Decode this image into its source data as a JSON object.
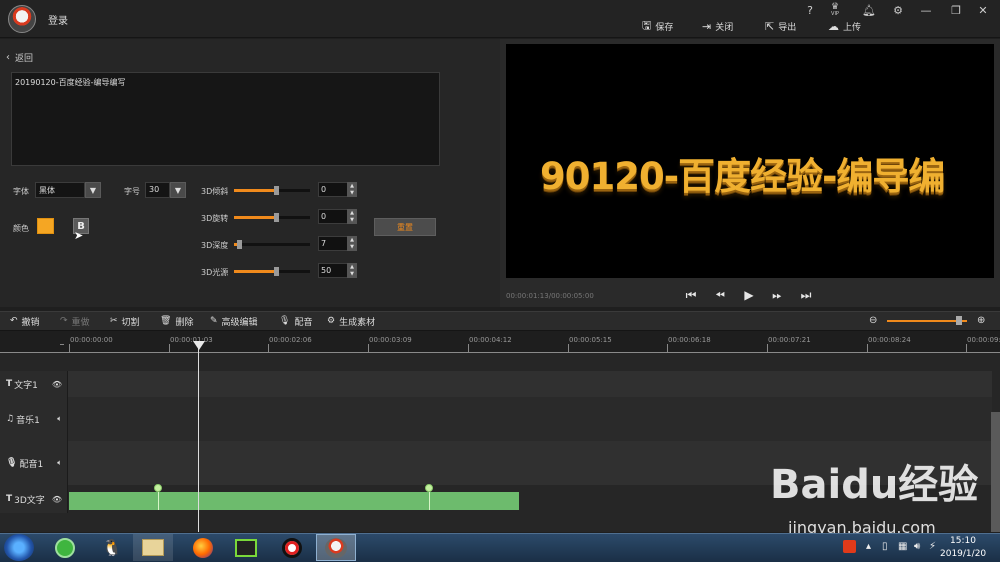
{
  "titlebar": {
    "login": "登录",
    "help_icon": "?",
    "vip_label": "VIP",
    "buttons": [
      {
        "label": "保存",
        "icon": "save-icon"
      },
      {
        "label": "关闭",
        "icon": "close-project-icon"
      },
      {
        "label": "导出",
        "icon": "export-icon"
      },
      {
        "label": "上传",
        "icon": "upload-icon"
      }
    ]
  },
  "editor": {
    "back_label": "返回",
    "text_content": "20190120-百度经验-编导编写",
    "font_label": "字体",
    "font_value": "黑体",
    "size_label": "字号",
    "size_value": "30",
    "color_label": "颜色",
    "color_value": "#f5a623",
    "bold_label": "B",
    "reset_label": "重置",
    "params": [
      {
        "label": "3D倾斜",
        "value": "0",
        "level": 0.55
      },
      {
        "label": "3D旋转",
        "value": "0",
        "level": 0.55
      },
      {
        "label": "3D深度",
        "value": "7",
        "level": 0.07
      },
      {
        "label": "3D光源",
        "value": "50",
        "level": 0.55
      }
    ]
  },
  "preview": {
    "text": "90120-百度经验-编导编",
    "timecode": "00:00:01:13/00:00:05:00"
  },
  "toolbar": {
    "items": [
      {
        "label": "撤销",
        "icon": "undo-icon",
        "enabled": true
      },
      {
        "label": "重做",
        "icon": "redo-icon",
        "enabled": false
      },
      {
        "label": "切割",
        "icon": "scissors-icon",
        "enabled": true
      },
      {
        "label": "删除",
        "icon": "trash-icon",
        "enabled": true
      },
      {
        "label": "高级编辑",
        "icon": "pencil-icon",
        "enabled": true
      },
      {
        "label": "配音",
        "icon": "microphone-icon",
        "enabled": true
      },
      {
        "label": "生成素材",
        "icon": "gear-icon",
        "enabled": true
      }
    ],
    "zoom_level": 0.9
  },
  "timeline": {
    "ruler": [
      "00:00:00:00",
      "00:00:01:03",
      "00:00:02:06",
      "00:00:03:09",
      "00:00:04:12",
      "00:00:05:15",
      "00:00:06:18",
      "00:00:07:21",
      "00:00:08:24",
      "00:00:09:"
    ],
    "tracks": [
      {
        "label": "文字1",
        "type_icon": "text-icon",
        "toggle_icon": "eye-icon"
      },
      {
        "label": "音乐1",
        "type_icon": "music-icon",
        "toggle_icon": "speaker-icon"
      },
      {
        "label": "配音1",
        "type_icon": "microphone-icon",
        "toggle_icon": "speaker-icon"
      },
      {
        "label": "3D文字",
        "type_icon": "text-icon",
        "toggle_icon": "eye-icon"
      }
    ],
    "clip_color": "#6dbb6d"
  },
  "taskbar": {
    "time": "15:10",
    "date": "2019/1/20"
  },
  "watermark": {
    "brand": "Baidu经验",
    "url": "jingyan.baidu.com"
  },
  "colors": {
    "accent": "#f08a1c",
    "background": "#1f1f1f"
  }
}
